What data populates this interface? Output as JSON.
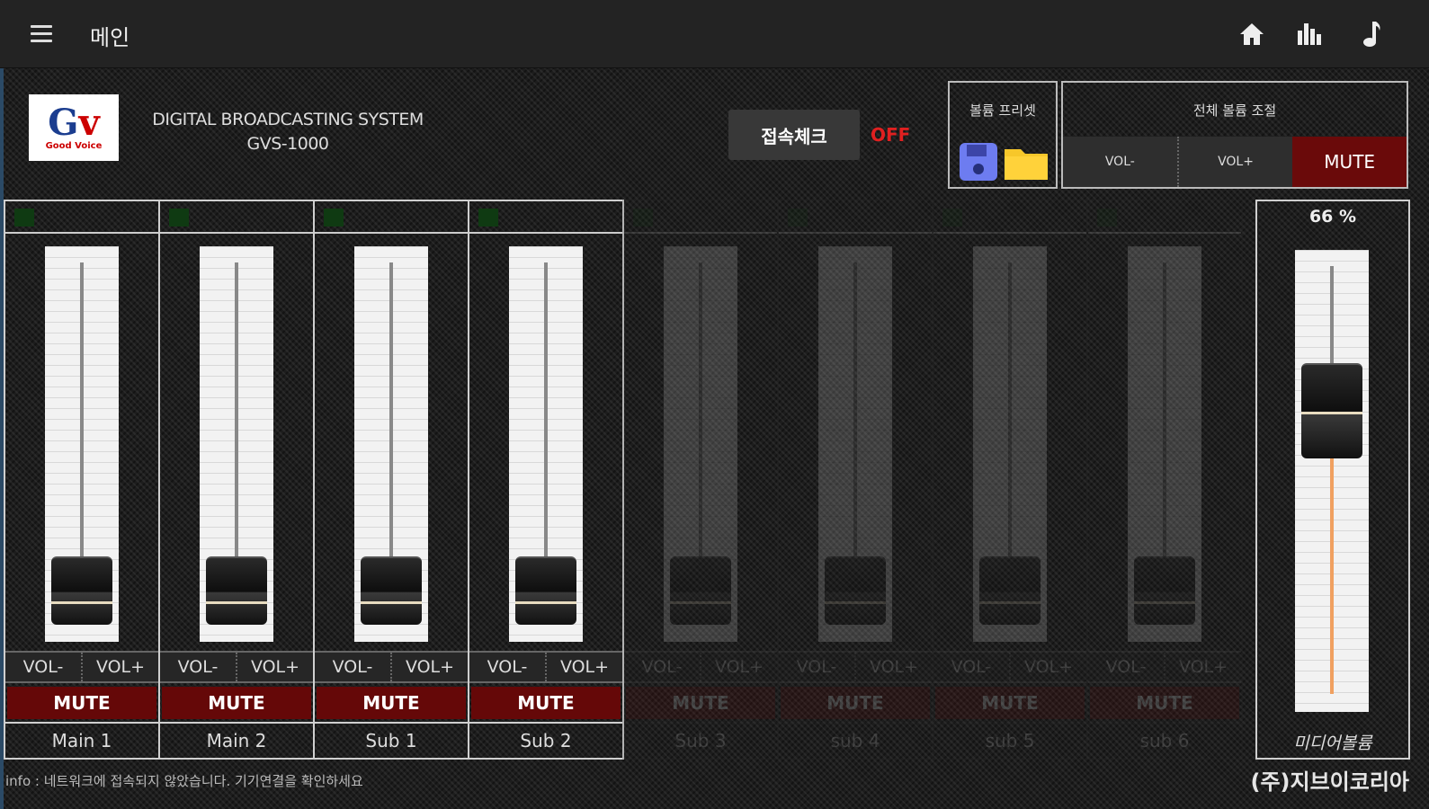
{
  "header": {
    "title": "메인",
    "icons": [
      "menu-icon",
      "home-icon",
      "bar-chart-icon",
      "music-note-icon"
    ]
  },
  "brand": {
    "logo_text": "Gv",
    "logo_sub": "Good Voice",
    "system_line1": "DIGITAL BROADCASTING SYSTEM",
    "system_line2": "GVS-1000"
  },
  "connection": {
    "check_label": "접속체크",
    "status": "OFF",
    "status_color": "#e02020"
  },
  "preset": {
    "title": "볼륨 프리셋",
    "save_icon": "floppy-save-icon",
    "load_icon": "folder-open-icon"
  },
  "master": {
    "title": "전체 볼륨 조절",
    "vol_minus": "VOL-",
    "vol_plus": "VOL+",
    "mute": "MUTE"
  },
  "channels": [
    {
      "name": "Main 1",
      "enabled": true,
      "level": 0.05,
      "vol_minus": "VOL-",
      "vol_plus": "VOL+",
      "mute": "MUTE"
    },
    {
      "name": "Main 2",
      "enabled": true,
      "level": 0.05,
      "vol_minus": "VOL-",
      "vol_plus": "VOL+",
      "mute": "MUTE"
    },
    {
      "name": "Sub 1",
      "enabled": true,
      "level": 0.05,
      "vol_minus": "VOL-",
      "vol_plus": "VOL+",
      "mute": "MUTE"
    },
    {
      "name": "Sub 2",
      "enabled": true,
      "level": 0.05,
      "vol_minus": "VOL-",
      "vol_plus": "VOL+",
      "mute": "MUTE"
    },
    {
      "name": "Sub 3",
      "enabled": false,
      "level": 0.05,
      "vol_minus": "VOL-",
      "vol_plus": "VOL+",
      "mute": "MUTE"
    },
    {
      "name": "sub 4",
      "enabled": false,
      "level": 0.05,
      "vol_minus": "VOL-",
      "vol_plus": "VOL+",
      "mute": "MUTE"
    },
    {
      "name": "sub 5",
      "enabled": false,
      "level": 0.05,
      "vol_minus": "VOL-",
      "vol_plus": "VOL+",
      "mute": "MUTE"
    },
    {
      "name": "sub 6",
      "enabled": false,
      "level": 0.05,
      "vol_minus": "VOL-",
      "vol_plus": "VOL+",
      "mute": "MUTE"
    }
  ],
  "media": {
    "percent_text": "66 %",
    "level": 0.66,
    "label": "미디어볼륨"
  },
  "footer": {
    "info": "info : 네트워크에 접속되지 않았습니다. 기기연결을 확인하세요",
    "company": "(주)지브이코리아"
  },
  "colors": {
    "mute_red": "#650808",
    "media_fill": "#f0a060"
  }
}
